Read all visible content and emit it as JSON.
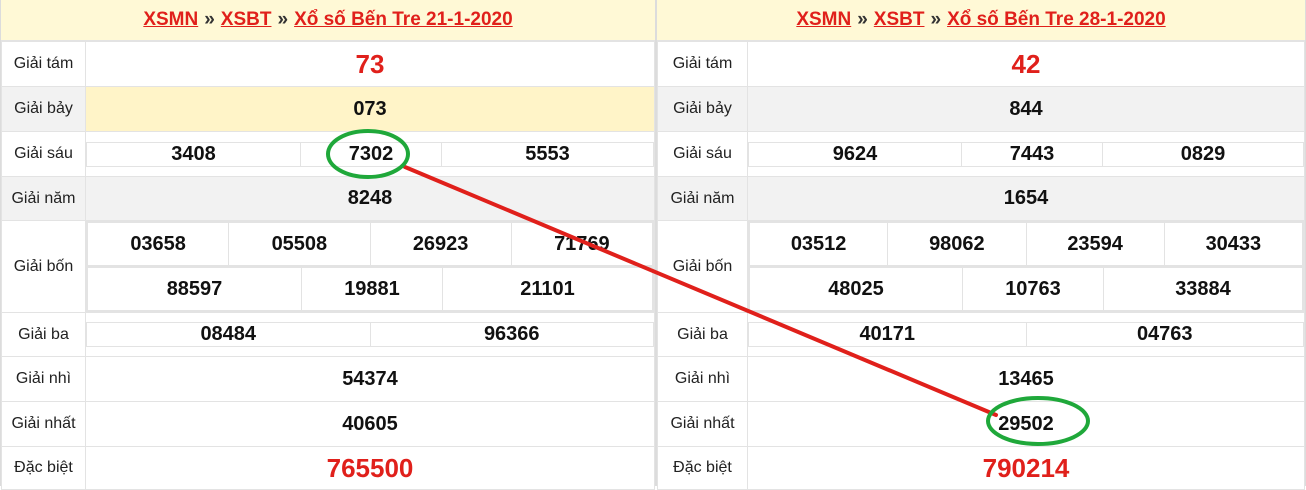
{
  "left": {
    "header": {
      "link1": "XSMN",
      "sep1": "»",
      "link2": "XSBT",
      "sep2": "»",
      "link3": "Xổ số Bến Tre 21-1-2020"
    },
    "rows": {
      "tam": {
        "label": "Giải tám",
        "value": "73"
      },
      "bay": {
        "label": "Giải bảy",
        "value": "073"
      },
      "sau": {
        "label": "Giải sáu",
        "values": [
          "3408",
          "7302",
          "5553"
        ]
      },
      "nam": {
        "label": "Giải năm",
        "value": "8248"
      },
      "bon": {
        "label": "Giải bốn",
        "row1": [
          "03658",
          "05508",
          "26923",
          "71769"
        ],
        "row2": [
          "88597",
          "19881",
          "21101"
        ]
      },
      "ba": {
        "label": "Giải ba",
        "values": [
          "08484",
          "96366"
        ]
      },
      "nhi": {
        "label": "Giải nhì",
        "value": "54374"
      },
      "nhat": {
        "label": "Giải nhất",
        "value": "40605"
      },
      "db": {
        "label": "Đặc biệt",
        "value": "765500"
      }
    }
  },
  "right": {
    "header": {
      "link1": "XSMN",
      "sep1": "»",
      "link2": "XSBT",
      "sep2": "»",
      "link3": "Xổ số Bến Tre 28-1-2020"
    },
    "rows": {
      "tam": {
        "label": "Giải tám",
        "value": "42"
      },
      "bay": {
        "label": "Giải bảy",
        "value": "844"
      },
      "sau": {
        "label": "Giải sáu",
        "values": [
          "9624",
          "7443",
          "0829"
        ]
      },
      "nam": {
        "label": "Giải năm",
        "value": "1654"
      },
      "bon": {
        "label": "Giải bốn",
        "row1": [
          "03512",
          "98062",
          "23594",
          "30433"
        ],
        "row2": [
          "48025",
          "10763",
          "33884"
        ]
      },
      "ba": {
        "label": "Giải ba",
        "values": [
          "40171",
          "04763"
        ]
      },
      "nhi": {
        "label": "Giải nhì",
        "value": "13465"
      },
      "nhat": {
        "label": "Giải nhất",
        "value": "29502"
      },
      "db": {
        "label": "Đặc biệt",
        "value": "790214"
      }
    }
  },
  "colors": {
    "red": "#e0201b",
    "highlight_green": "#1fa83a",
    "header_bg": "#fff9d6",
    "row_shade": "#f2f2f2",
    "row_yellow": "#fff4c8"
  }
}
